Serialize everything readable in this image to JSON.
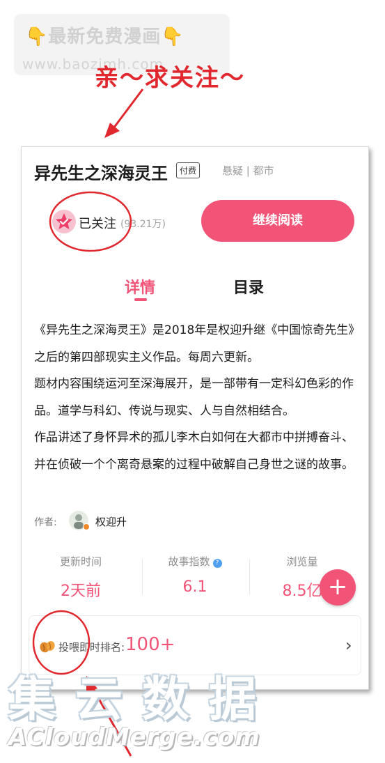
{
  "watermark_top": {
    "line1": "最新免费漫画",
    "line2": "www.baozimh.com"
  },
  "plea": "亲～求关注～",
  "comic": {
    "title": "异先生之深海灵王",
    "paid_badge": "付费",
    "genre": "悬疑 | 都市"
  },
  "follow": {
    "label": "已关注",
    "count": "(93.21万)"
  },
  "read_button": "继续阅读",
  "tabs": {
    "detail": "详情",
    "toc": "目录"
  },
  "description": [
    "《异先生之深海灵王》是2018年是权迎升继《中国惊奇先生》之后的第四部现实主义作品。每周六更新。",
    "题材内容围绕运河至深海展开，是一部带有一定科幻色彩的作品。道学与科幻、传说与现实、人与自然相结合。",
    "作品讲述了身怀异术的孤儿李木白如何在大都市中拼搏奋斗、并在侦破一个个离奇悬案的过程中破解自己身世之谜的故事。"
  ],
  "author": {
    "label": "作者:",
    "name": "权迎升"
  },
  "stats": [
    {
      "label": "更新时间",
      "value": "2天前"
    },
    {
      "label": "故事指数",
      "value": "6.1",
      "help": "?"
    },
    {
      "label": "浏览量",
      "value": "8.5亿"
    }
  ],
  "fab": "+",
  "rank": {
    "label": "投喂即时排名:",
    "value": "100+",
    "chevron": "›"
  },
  "watermark_bottom": {
    "cn": "集云数据",
    "en": "ACloudMerge.com"
  },
  "colors": {
    "accent": "#f25478",
    "annotation": "#e0282e"
  },
  "icons": [
    "pointing-hand-icon",
    "star-check-icon",
    "feed-beans-icon",
    "chevron-right-icon",
    "plus-icon",
    "help-icon",
    "arrow-icon"
  ]
}
